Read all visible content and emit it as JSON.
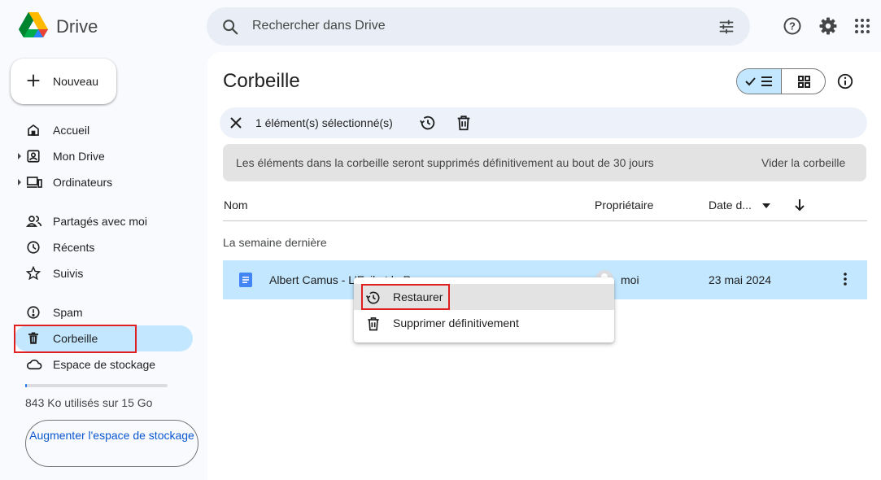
{
  "app": {
    "title": "Drive"
  },
  "search": {
    "placeholder": "Rechercher dans Drive"
  },
  "sidebar": {
    "new_label": "Nouveau",
    "items": [
      {
        "label": "Accueil",
        "icon": "home-icon"
      },
      {
        "label": "Mon Drive",
        "icon": "my-drive-icon"
      },
      {
        "label": "Ordinateurs",
        "icon": "computers-icon"
      },
      {
        "label": "Partagés avec moi",
        "icon": "people-icon"
      },
      {
        "label": "Récents",
        "icon": "clock-icon"
      },
      {
        "label": "Suivis",
        "icon": "star-icon"
      },
      {
        "label": "Spam",
        "icon": "spam-icon"
      },
      {
        "label": "Corbeille",
        "icon": "trash-icon"
      },
      {
        "label": "Espace de stockage",
        "icon": "cloud-icon"
      }
    ],
    "storage_text": "843 Ko utilisés sur 15 Go",
    "storage_fraction": 0.01,
    "upgrade_label": "Augmenter l'espace de stockage"
  },
  "main": {
    "title": "Corbeille",
    "selection_text": "1 élément(s) sélectionné(s)",
    "banner_text": "Les éléments dans la corbeille seront supprimés définitivement au bout de 30 jours",
    "banner_action": "Vider la corbeille",
    "columns": {
      "name": "Nom",
      "owner": "Propriétaire",
      "date": "Date d..."
    },
    "group_label": "La semaine dernière",
    "files": [
      {
        "name": "Albert Camus - L'Exil et le R",
        "owner": "moi",
        "date": "23 mai 2024"
      }
    ]
  },
  "context_menu": {
    "items": [
      {
        "label": "Restaurer",
        "icon": "restore-icon"
      },
      {
        "label": "Supprimer définitivement",
        "icon": "trash-icon"
      }
    ]
  },
  "colors": {
    "accent": "#0b57d0",
    "selected_bg": "#c2e7ff",
    "highlight_box": "#e02020"
  }
}
